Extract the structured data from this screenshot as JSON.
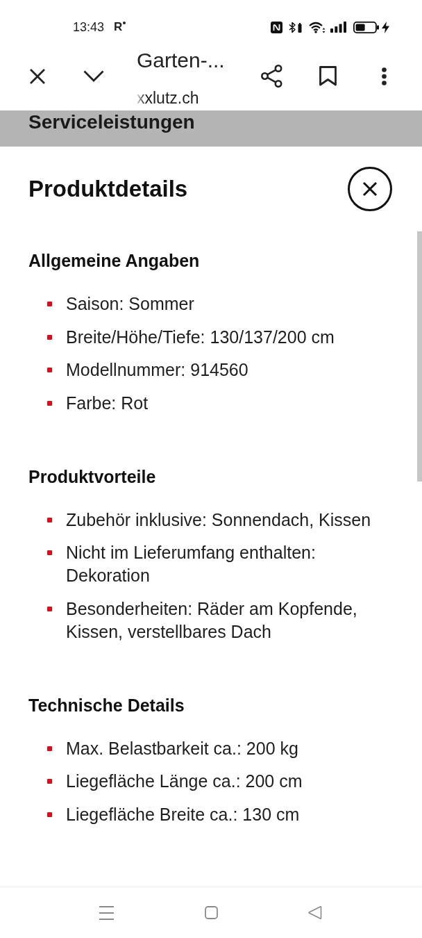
{
  "status_bar": {
    "time": "13:43",
    "indicator": "R"
  },
  "browser_bar": {
    "title": "Garten-...",
    "url": "xxlutz.ch"
  },
  "sticky_header": {
    "title": "Serviceleistungen"
  },
  "panel": {
    "title": "Produktdetails",
    "sections": [
      {
        "heading": "Allgemeine Angaben",
        "items": [
          "Saison: Sommer",
          "Breite/Höhe/Tiefe: 130/137/200 cm",
          "Modellnummer: 914560",
          "Farbe: Rot"
        ]
      },
      {
        "heading": "Produktvorteile",
        "items": [
          "Zubehör inklusive: Sonnendach, Kissen",
          "Nicht im Lieferumfang enthalten: Dekoration",
          "Besonderheiten: Räder am Kopfende, Kissen, verstellbares Dach"
        ]
      },
      {
        "heading": "Technische Details",
        "items": [
          "Max. Belastbarkeit ca.: 200 kg",
          "Liegefläche Länge ca.: 200 cm",
          "Liegefläche Breite ca.: 130 cm"
        ]
      }
    ]
  }
}
